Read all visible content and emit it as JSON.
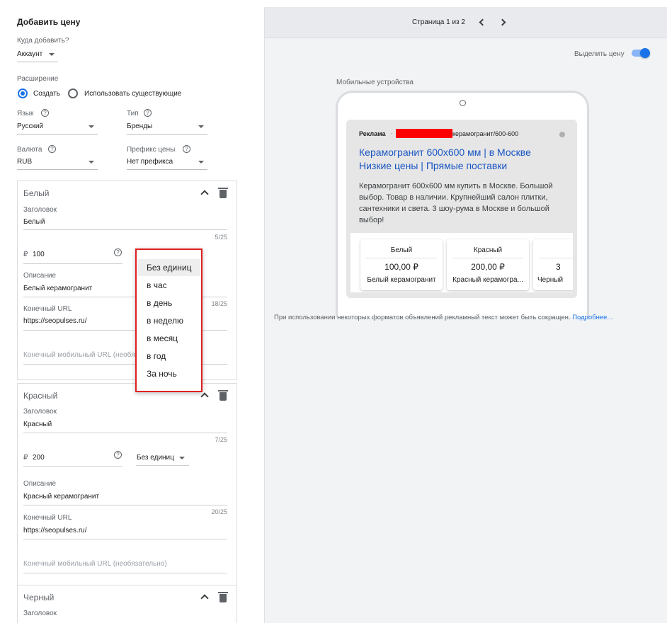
{
  "left": {
    "title": "Добавить цену",
    "where_label": "Куда добавить?",
    "where_value": "Аккаунт",
    "extension_label": "Расширение",
    "radio_create": "Создать",
    "radio_existing": "Использовать существующие",
    "language_label": "Язык",
    "language_value": "Русский",
    "type_label": "Тип",
    "type_value": "Бренды",
    "currency_label": "Валюта",
    "currency_value": "RUB",
    "prefix_label": "Префикс цены",
    "prefix_value": "Нет префикса",
    "help_glyph": "?",
    "currency_symbol": "₽"
  },
  "items": [
    {
      "name": "Белый",
      "header_label": "Заголовок",
      "header_value": "Белый",
      "header_count": "5/25",
      "price": "100",
      "desc_label": "Описание",
      "desc_value": "Белый керамогранит",
      "desc_count": "18/25",
      "url_label": "Конечный URL",
      "url_value": "https://seopulses.ru/",
      "mobile_url_label": "Конечный мобильный URL (необя"
    },
    {
      "name": "Красный",
      "header_label": "Заголовок",
      "header_value": "Красный",
      "header_count": "7/25",
      "price": "200",
      "unit": "Без единиц",
      "desc_label": "Описание",
      "desc_value": "Красный керамогранит",
      "desc_count": "20/25",
      "url_label": "Конечный URL",
      "url_value": "https://seopulses.ru/",
      "mobile_url_label": "Конечный мобильный URL (необязательно)"
    },
    {
      "name": "Черный",
      "header_label": "Заголовок"
    }
  ],
  "unit_menu": {
    "options": [
      "Без единиц",
      "в час",
      "в день",
      "в неделю",
      "в месяц",
      "в год",
      "За ночь"
    ],
    "selected": "Без единиц"
  },
  "right": {
    "pager": "Страница 1 из 2",
    "highlight_label": "Выделить цену",
    "highlight_on": true,
    "device_label": "Мобильные устройства",
    "ad_badge": "Реклама",
    "ad_url_suffix": "керамогранит/600-600",
    "ad_title_1": "Керамогранит 600x600 мм | в Москве",
    "ad_title_2": "Низкие цены | Прямые поставки",
    "ad_desc": "Керамогранит 600x600 мм купить в Москве. Большой выбор. Товар в наличии. Крупнейший салон плитки, сантехники и света. 3 шоу-рума в Москве и большой выбор!",
    "price_cards": [
      {
        "header": "Белый",
        "price": "100,00 ₽",
        "desc": "Белый керамогранит"
      },
      {
        "header": "Красный",
        "price": "200,00 ₽",
        "desc": "Красный керамогра..."
      },
      {
        "header": "",
        "price": "3",
        "desc": "Черный"
      }
    ],
    "note": "При использовании некоторых форматов объявлений рекламный текст может быть сокращен.",
    "note_link": "Подробнее..."
  },
  "colors": {
    "accent": "#1a73e8",
    "link": "#1a56c4",
    "highlight_border": "#e02020",
    "redaction": "#ff0000"
  }
}
